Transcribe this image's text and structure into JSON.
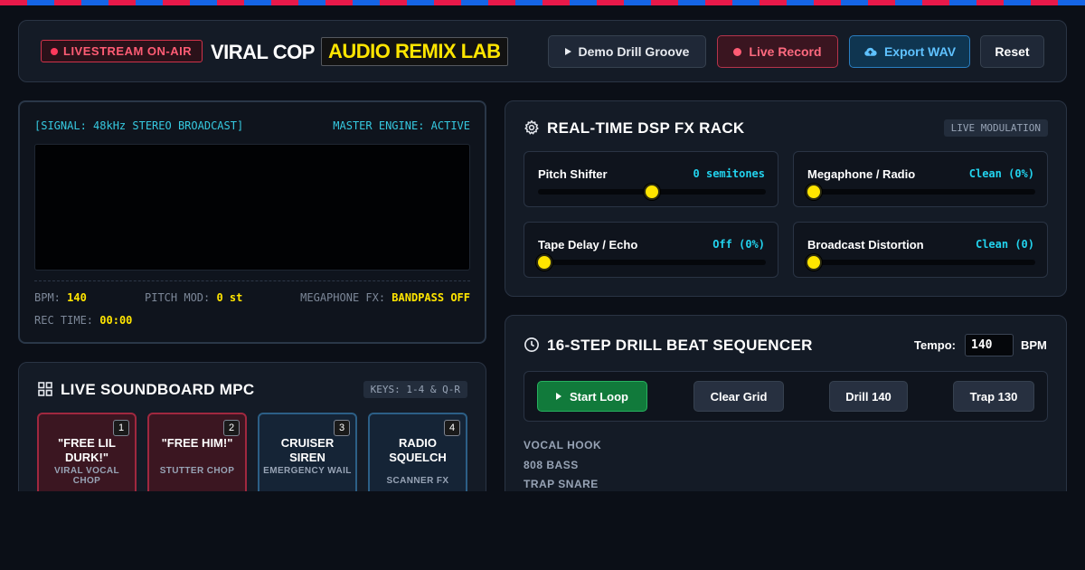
{
  "header": {
    "onair_label": "LIVESTREAM ON-AIR",
    "title_main": "VIRAL COP",
    "title_highlight": "AUDIO REMIX LAB",
    "buttons": {
      "demo": "Demo Drill Groove",
      "record": "Live Record",
      "export": "Export WAV",
      "reset": "Reset"
    }
  },
  "scope": {
    "signal": "[SIGNAL: 48kHz STEREO BROADCAST]",
    "engine": "MASTER ENGINE: ACTIVE",
    "stats": {
      "bpm_label": "BPM:",
      "bpm_value": "140",
      "pitch_label": "PITCH MOD:",
      "pitch_value": "0 st",
      "mega_label": "MEGAPHONE FX:",
      "mega_value": "BANDPASS OFF",
      "rec_label": "REC TIME:",
      "rec_value": "00:00"
    }
  },
  "soundboard": {
    "title": "LIVE SOUNDBOARD MPC",
    "keys_tag": "KEYS: 1-4 & Q-R",
    "pads": [
      {
        "num": "1",
        "name": "\"FREE LIL DURK!\"",
        "sub": "VIRAL VOCAL CHOP",
        "color": "red"
      },
      {
        "num": "2",
        "name": "\"FREE HIM!\"",
        "sub": "STUTTER CHOP",
        "color": "red"
      },
      {
        "num": "3",
        "name": "CRUISER SIREN",
        "sub": "EMERGENCY WAIL",
        "color": "blue"
      },
      {
        "num": "4",
        "name": "RADIO SQUELCH",
        "sub": "SCANNER FX",
        "color": "blue"
      }
    ]
  },
  "fx_rack": {
    "title": "REAL-TIME DSP FX RACK",
    "tag": "LIVE MODULATION",
    "controls": [
      {
        "name": "Pitch Shifter",
        "value": "0 semitones",
        "level": 0.5
      },
      {
        "name": "Megaphone / Radio",
        "value": "Clean (0%)",
        "level": 0
      },
      {
        "name": "Tape Delay / Echo",
        "value": "Off (0%)",
        "level": 0
      },
      {
        "name": "Broadcast Distortion",
        "value": "Clean (0)",
        "level": 0
      }
    ]
  },
  "sequencer": {
    "title": "16-STEP DRILL BEAT SEQUENCER",
    "tempo_label": "Tempo:",
    "tempo_value": "140",
    "bpm_label": "BPM",
    "buttons": {
      "start": "Start Loop",
      "clear": "Clear Grid",
      "drill": "Drill 140",
      "trap": "Trap 130"
    },
    "tracks": [
      "VOCAL HOOK",
      "808 BASS",
      "TRAP SNARE"
    ]
  },
  "colors": {
    "accent_yellow": "#ffe500",
    "accent_cyan": "#22d3ee",
    "alert_red": "#ff5c74",
    "stripe_red": "#e8194a",
    "stripe_blue": "#1565e6"
  }
}
